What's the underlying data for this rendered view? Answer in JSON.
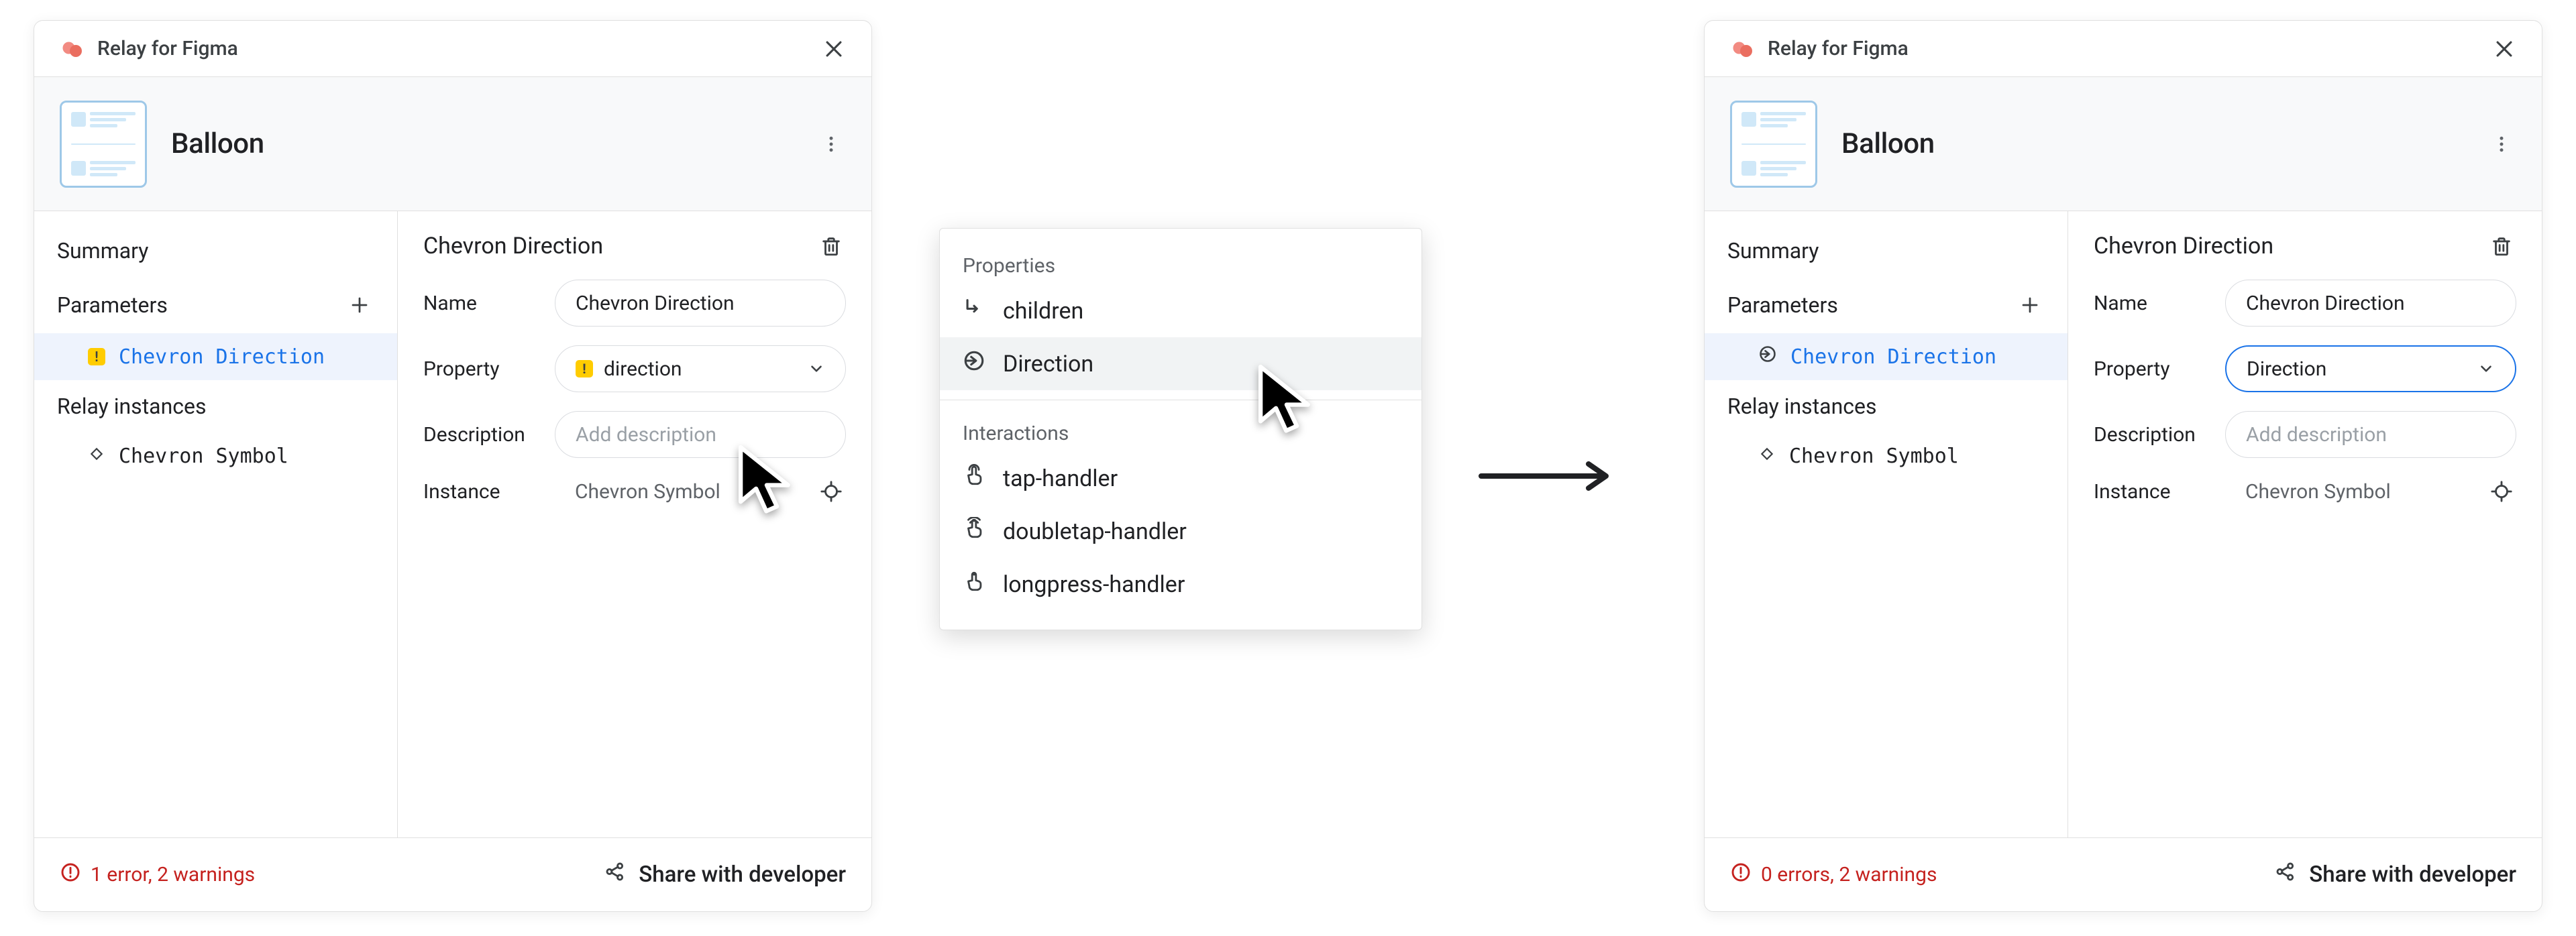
{
  "left": {
    "header_title": "Relay for Figma",
    "component_name": "Balloon",
    "sidebar": {
      "summary_label": "Summary",
      "parameters_label": "Parameters",
      "param_name": "Chevron Direction",
      "relay_instances_label": "Relay instances",
      "instance_name": "Chevron Symbol"
    },
    "detail": {
      "title": "Chevron Direction",
      "name_label": "Name",
      "name_value": "Chevron Direction",
      "property_label": "Property",
      "property_value": "direction",
      "description_label": "Description",
      "description_placeholder": "Add description",
      "instance_label": "Instance",
      "instance_value": "Chevron Symbol"
    },
    "footer": {
      "status_text": "1 error, 2 warnings",
      "share_label": "Share with developer"
    }
  },
  "popup": {
    "properties_label": "Properties",
    "interactions_label": "Interactions",
    "items_properties": [
      "children",
      "Direction"
    ],
    "items_interactions": [
      "tap-handler",
      "doubletap-handler",
      "longpress-handler"
    ],
    "selected_index": 1
  },
  "right": {
    "header_title": "Relay for Figma",
    "component_name": "Balloon",
    "sidebar": {
      "summary_label": "Summary",
      "parameters_label": "Parameters",
      "param_name": "Chevron Direction",
      "relay_instances_label": "Relay instances",
      "instance_name": "Chevron Symbol"
    },
    "detail": {
      "title": "Chevron Direction",
      "name_label": "Name",
      "name_value": "Chevron Direction",
      "property_label": "Property",
      "property_value": "Direction",
      "description_label": "Description",
      "description_placeholder": "Add description",
      "instance_label": "Instance",
      "instance_value": "Chevron Symbol"
    },
    "footer": {
      "status_text": "0 errors, 2 warnings",
      "share_label": "Share with developer"
    }
  }
}
